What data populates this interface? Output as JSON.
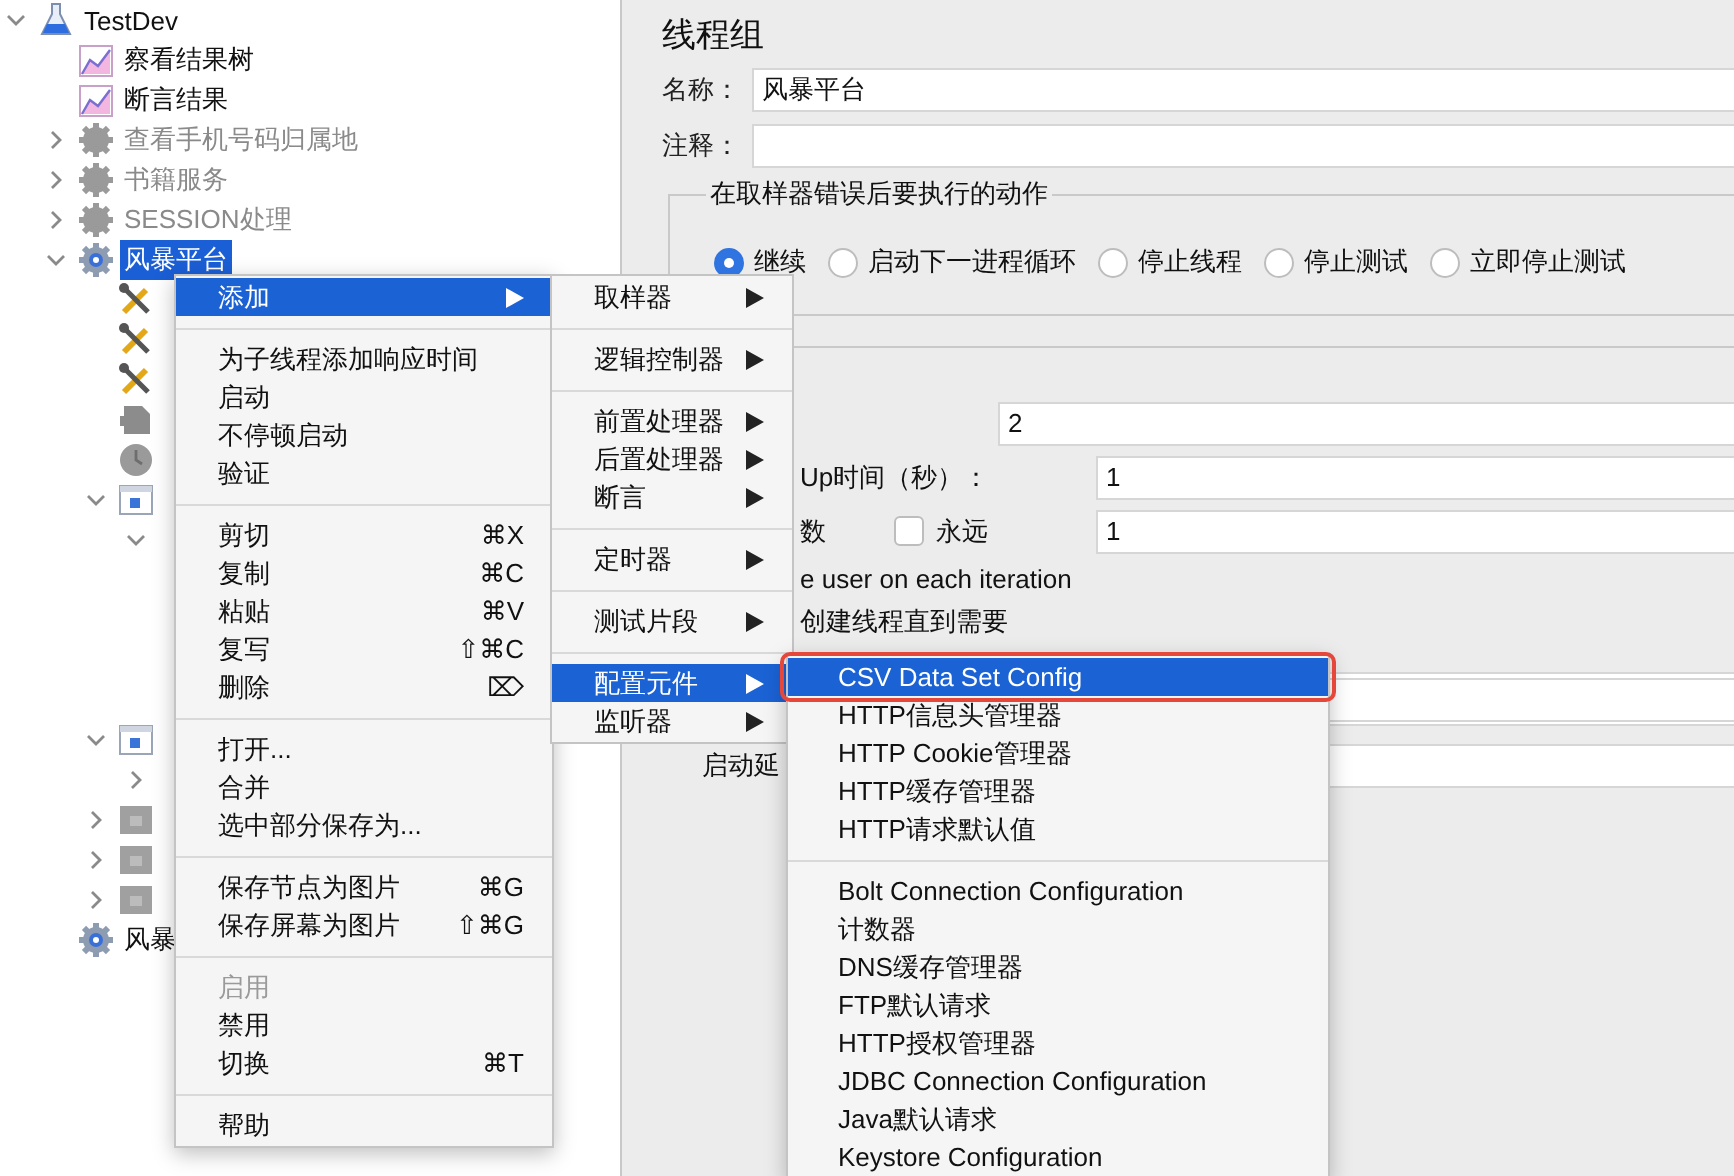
{
  "tree": [
    {
      "label": "TestDev",
      "kind": "flask",
      "expanded": true,
      "selected": false,
      "children": [
        {
          "label": "察看结果树",
          "kind": "chart",
          "selected": false,
          "disabled": false
        },
        {
          "label": "断言结果",
          "kind": "chart",
          "selected": false,
          "disabled": false
        },
        {
          "label": "查看手机号码归属地",
          "kind": "gear",
          "expanded": false,
          "selected": false,
          "disabled": true
        },
        {
          "label": "书籍服务",
          "kind": "gear",
          "expanded": false,
          "selected": false,
          "disabled": true
        },
        {
          "label": "SESSION处理",
          "kind": "gear",
          "expanded": false,
          "selected": false,
          "disabled": true
        },
        {
          "label": "风暴平台",
          "kind": "gear",
          "expanded": true,
          "selected": true,
          "disabled": false,
          "children": [
            {
              "kind": "wrench"
            },
            {
              "kind": "wrench"
            },
            {
              "kind": "wrench"
            },
            {
              "kind": "block"
            },
            {
              "kind": "timer"
            },
            {
              "kind": "controller",
              "expanded": true,
              "children": [
                {
                  "expanded": true
                }
              ]
            },
            {
              "kind": "controller",
              "expanded": true,
              "children": [
                {
                  "expanded": false
                }
              ]
            },
            {
              "kind": "module",
              "expanded": false
            },
            {
              "kind": "module",
              "expanded": false
            },
            {
              "kind": "module",
              "expanded": false
            }
          ]
        },
        {
          "label": "风暴",
          "kind": "gear",
          "selected": false,
          "disabled": false
        }
      ]
    }
  ],
  "panel": {
    "title": "线程组",
    "name_label": "名称：",
    "name_value": "风暴平台",
    "comment_label": "注释：",
    "error_action": {
      "legend": "在取样器错误后要执行的动作",
      "options": [
        {
          "label": "继续",
          "selected": true
        },
        {
          "label": "启动下一进程循环",
          "selected": false
        },
        {
          "label": "停止线程",
          "selected": false
        },
        {
          "label": "停止测试",
          "selected": false
        },
        {
          "label": "立即停止测试",
          "selected": false
        }
      ]
    },
    "thread_props": [
      {
        "kind": "count",
        "value": "2"
      },
      {
        "kind": "ramp",
        "label": "Up时间（秒）：",
        "value": "1"
      },
      {
        "kind": "loop",
        "label": "数",
        "checkbox_label": "永远",
        "checked": false,
        "value": "1"
      },
      {
        "kind": "text",
        "label": "e user on each iteration"
      },
      {
        "kind": "text",
        "label": "创建线程直到需要"
      },
      {
        "kind": "field"
      },
      {
        "kind": "delay",
        "label": "启动延"
      }
    ]
  },
  "context_menu": {
    "groups": [
      [
        {
          "label": "添加",
          "submenu": true,
          "selected": true,
          "disabled": false
        }
      ],
      [
        {
          "label": "为子线程添加响应时间",
          "submenu": false,
          "selected": false,
          "disabled": false
        },
        {
          "label": "启动",
          "submenu": false,
          "selected": false,
          "disabled": false
        },
        {
          "label": "不停顿启动",
          "submenu": false,
          "selected": false,
          "disabled": false
        },
        {
          "label": "验证",
          "submenu": false,
          "selected": false,
          "disabled": false
        }
      ],
      [
        {
          "label": "剪切",
          "shortcut": "⌘X",
          "submenu": false,
          "selected": false,
          "disabled": false
        },
        {
          "label": "复制",
          "shortcut": "⌘C",
          "submenu": false,
          "selected": false,
          "disabled": false
        },
        {
          "label": "粘贴",
          "shortcut": "⌘V",
          "submenu": false,
          "selected": false,
          "disabled": false
        },
        {
          "label": "复写",
          "shortcut": "⇧⌘C",
          "submenu": false,
          "selected": false,
          "disabled": false
        },
        {
          "label": "删除",
          "shortcut": "⌦",
          "submenu": false,
          "selected": false,
          "disabled": false
        }
      ],
      [
        {
          "label": "打开...",
          "submenu": false,
          "selected": false,
          "disabled": false
        },
        {
          "label": "合并",
          "submenu": false,
          "selected": false,
          "disabled": false
        },
        {
          "label": "选中部分保存为...",
          "submenu": false,
          "selected": false,
          "disabled": false
        }
      ],
      [
        {
          "label": "保存节点为图片",
          "shortcut": "⌘G",
          "submenu": false,
          "selected": false,
          "disabled": false
        },
        {
          "label": "保存屏幕为图片",
          "shortcut": "⇧⌘G",
          "submenu": false,
          "selected": false,
          "disabled": false
        }
      ],
      [
        {
          "label": "启用",
          "submenu": false,
          "selected": false,
          "disabled": true
        },
        {
          "label": "禁用",
          "submenu": false,
          "selected": false,
          "disabled": false
        },
        {
          "label": "切换",
          "shortcut": "⌘T",
          "submenu": false,
          "selected": false,
          "disabled": false
        }
      ],
      [
        {
          "label": "帮助",
          "submenu": false,
          "selected": false,
          "disabled": false
        }
      ]
    ]
  },
  "add_submenu": {
    "groups": [
      [
        {
          "label": "取样器",
          "submenu": true,
          "selected": false
        }
      ],
      [
        {
          "label": "逻辑控制器",
          "submenu": true,
          "selected": false
        }
      ],
      [
        {
          "label": "前置处理器",
          "submenu": true,
          "selected": false
        },
        {
          "label": "后置处理器",
          "submenu": true,
          "selected": false
        },
        {
          "label": "断言",
          "submenu": true,
          "selected": false
        }
      ],
      [
        {
          "label": "定时器",
          "submenu": true,
          "selected": false
        }
      ],
      [
        {
          "label": "测试片段",
          "submenu": true,
          "selected": false
        }
      ],
      [
        {
          "label": "配置元件",
          "submenu": true,
          "selected": true
        },
        {
          "label": "监听器",
          "submenu": true,
          "selected": false
        }
      ]
    ]
  },
  "config_submenu": {
    "groups": [
      [
        {
          "label": "CSV Data Set Config",
          "selected": true,
          "highlighted": true
        },
        {
          "label": "HTTP信息头管理器",
          "selected": false,
          "highlighted": false
        },
        {
          "label": "HTTP Cookie管理器",
          "selected": false,
          "highlighted": false
        },
        {
          "label": "HTTP缓存管理器",
          "selected": false,
          "highlighted": false
        },
        {
          "label": "HTTP请求默认值",
          "selected": false,
          "highlighted": false
        }
      ],
      [
        {
          "label": "Bolt Connection Configuration",
          "selected": false,
          "highlighted": false
        },
        {
          "label": "计数器",
          "selected": false,
          "highlighted": false
        },
        {
          "label": "DNS缓存管理器",
          "selected": false,
          "highlighted": false
        },
        {
          "label": "FTP默认请求",
          "selected": false,
          "highlighted": false
        },
        {
          "label": "HTTP授权管理器",
          "selected": false,
          "highlighted": false
        },
        {
          "label": "JDBC Connection Configuration",
          "selected": false,
          "highlighted": false
        },
        {
          "label": "Java默认请求",
          "selected": false,
          "highlighted": false
        },
        {
          "label": "Keystore Configuration",
          "selected": false,
          "highlighted": false
        }
      ]
    ]
  }
}
